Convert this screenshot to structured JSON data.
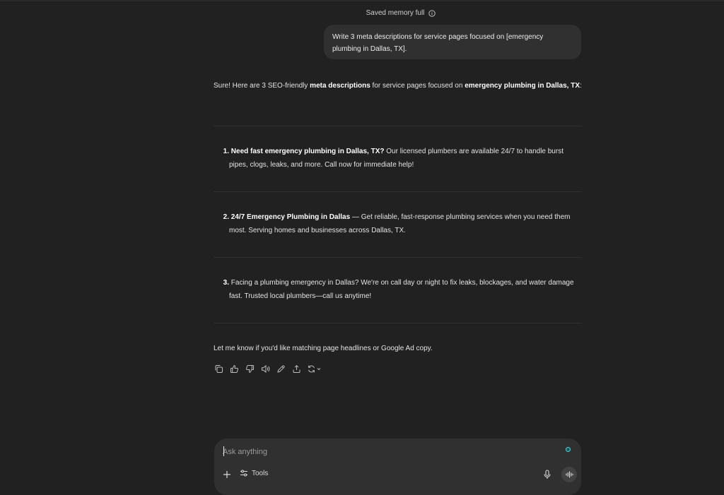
{
  "header": {
    "saved_memory": "Saved memory full"
  },
  "user_message": "Write 3 meta descriptions for service pages focused on [emergency plumbing in Dallas, TX].",
  "assistant": {
    "intro": {
      "part1": "Sure! Here are 3 SEO-friendly ",
      "bold1": "meta descriptions",
      "part2": " for service pages focused on ",
      "bold2": "emergency plumbing in Dallas, TX",
      "part3": ":"
    },
    "items": [
      {
        "num": "1.",
        "bold": "Need fast emergency plumbing in Dallas, TX?",
        "text": " Our licensed plumbers are available 24/7 to handle burst pipes, clogs, leaks, and more. Call now for immediate help!"
      },
      {
        "num": "2.",
        "bold": "24/7 Emergency Plumbing in Dallas",
        "text": " — Get reliable, fast-response plumbing services when you need them most. Serving homes and businesses across Dallas, TX."
      },
      {
        "num": "3.",
        "bold": "",
        "text": "Facing a plumbing emergency in Dallas? We're on call day or night to fix leaks, blockages, and water damage fast. Trusted local plumbers—call us anytime!"
      }
    ],
    "closing": "Let me know if you'd like matching page headlines or Google Ad copy."
  },
  "actions": [
    "copy-icon",
    "thumbs-up-icon",
    "thumbs-down-icon",
    "read-aloud-icon",
    "edit-icon",
    "share-icon",
    "regenerate-icon"
  ],
  "composer": {
    "placeholder": "Ask anything",
    "tools_label": "Tools"
  },
  "colors": {
    "background": "#212121",
    "bubble": "#303030",
    "text": "#ececec",
    "accent_dot": "#4fd0d8"
  }
}
